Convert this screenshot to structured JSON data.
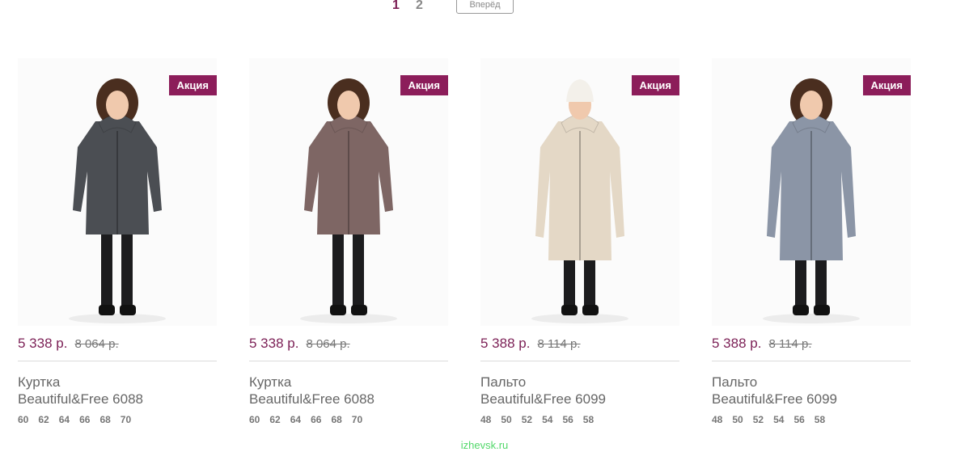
{
  "pagination": {
    "current": "1",
    "next_page": "2",
    "next_label": "Вперёд"
  },
  "products": [
    {
      "badge": "Акция",
      "price_new": "5 338 р.",
      "price_old": "8 064 р.",
      "title_line1": "Куртка",
      "title_line2": "Beautiful&Free 6088",
      "sizes": [
        "60",
        "62",
        "64",
        "66",
        "68",
        "70"
      ],
      "coat_color": "#4b4e53",
      "hat": false
    },
    {
      "badge": "Акция",
      "price_new": "5 338 р.",
      "price_old": "8 064 р.",
      "title_line1": "Куртка",
      "title_line2": "Beautiful&Free 6088",
      "sizes": [
        "60",
        "62",
        "64",
        "66",
        "68",
        "70"
      ],
      "coat_color": "#7e6664",
      "hat": false
    },
    {
      "badge": "Акция",
      "price_new": "5 388 р.",
      "price_old": "8 114 р.",
      "title_line1": "Пальто",
      "title_line2": "Beautiful&Free 6099",
      "sizes": [
        "48",
        "50",
        "52",
        "54",
        "56",
        "58"
      ],
      "coat_color": "#e4d8c6",
      "hat": true
    },
    {
      "badge": "Акция",
      "price_new": "5 388 р.",
      "price_old": "8 114 р.",
      "title_line1": "Пальто",
      "title_line2": "Beautiful&Free 6099",
      "sizes": [
        "48",
        "50",
        "52",
        "54",
        "56",
        "58"
      ],
      "coat_color": "#8b95a6",
      "hat": false
    }
  ],
  "watermark": "izhevsk.ru"
}
